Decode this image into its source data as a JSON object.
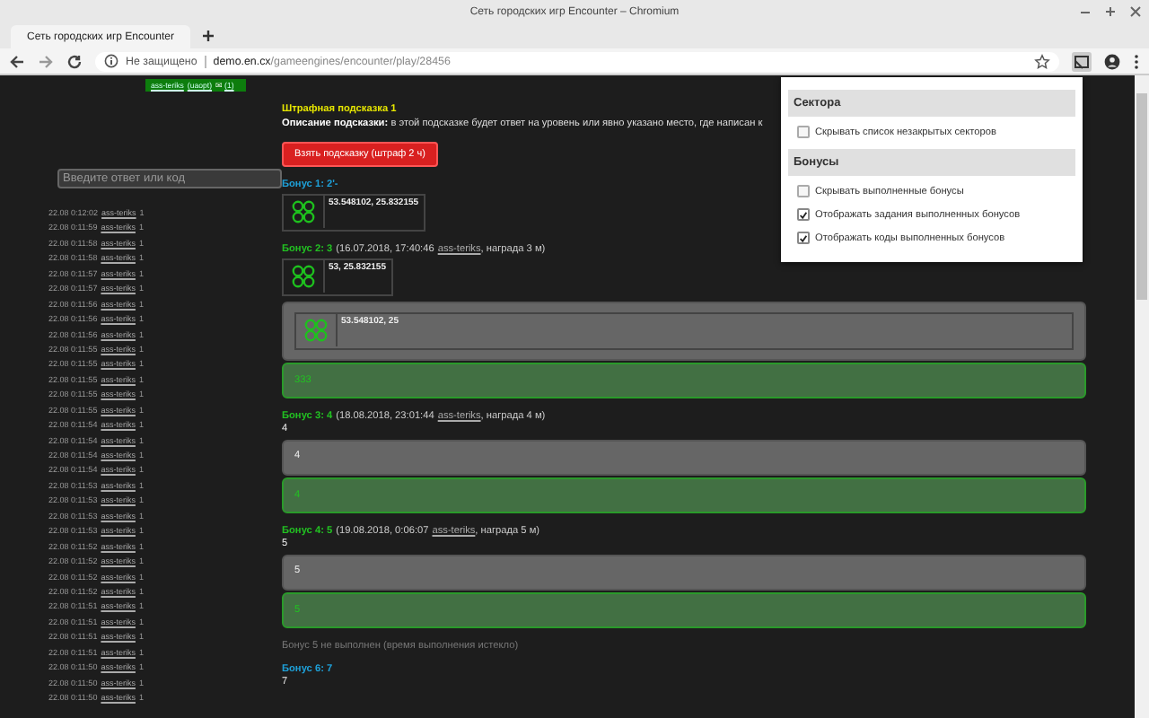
{
  "browser": {
    "window_title": "Сеть городских игр Encounter – Chromium",
    "tab_title": "Сеть городских игр Encounter",
    "security": "Не защищено",
    "url_host": "demo.en.cx",
    "url_path": "/gameengines/encounter/play/28456"
  },
  "sidebar": {
    "user_badge": {
      "user": "ass-teriks",
      "team": "(uaopt)",
      "mail": "✉",
      "mail_count": "(1)"
    },
    "answer_field": {
      "placeholder": "Введите ответ или код"
    },
    "log": [
      {
        "time": "22.08 0:12:02",
        "user": "ass-teriks",
        "value": "1"
      },
      {
        "time": "22.08 0:11:59",
        "user": "ass-teriks",
        "value": "1"
      },
      {
        "time": "22.08 0:11:58",
        "user": "ass-teriks",
        "value": "1"
      },
      {
        "time": "22.08 0:11:58",
        "user": "ass-teriks",
        "value": "1"
      },
      {
        "time": "22.08 0:11:57",
        "user": "ass-teriks",
        "value": "1"
      },
      {
        "time": "22.08 0:11:57",
        "user": "ass-teriks",
        "value": "1"
      },
      {
        "time": "22.08 0:11:56",
        "user": "ass-teriks",
        "value": "1"
      },
      {
        "time": "22.08 0:11:56",
        "user": "ass-teriks",
        "value": "1"
      },
      {
        "time": "22.08 0:11:56",
        "user": "ass-teriks",
        "value": "1"
      },
      {
        "time": "22.08 0:11:55",
        "user": "ass-teriks",
        "value": "1"
      },
      {
        "time": "22.08 0:11:55",
        "user": "ass-teriks",
        "value": "1"
      },
      {
        "time": "22.08 0:11:55",
        "user": "ass-teriks",
        "value": "1"
      },
      {
        "time": "22.08 0:11:55",
        "user": "ass-teriks",
        "value": "1"
      },
      {
        "time": "22.08 0:11:55",
        "user": "ass-teriks",
        "value": "1"
      },
      {
        "time": "22.08 0:11:54",
        "user": "ass-teriks",
        "value": "1"
      },
      {
        "time": "22.08 0:11:54",
        "user": "ass-teriks",
        "value": "1"
      },
      {
        "time": "22.08 0:11:54",
        "user": "ass-teriks",
        "value": "1"
      },
      {
        "time": "22.08 0:11:54",
        "user": "ass-teriks",
        "value": "1"
      },
      {
        "time": "22.08 0:11:53",
        "user": "ass-teriks",
        "value": "1"
      },
      {
        "time": "22.08 0:11:53",
        "user": "ass-teriks",
        "value": "1"
      },
      {
        "time": "22.08 0:11:53",
        "user": "ass-teriks",
        "value": "1"
      },
      {
        "time": "22.08 0:11:53",
        "user": "ass-teriks",
        "value": "1"
      },
      {
        "time": "22.08 0:11:52",
        "user": "ass-teriks",
        "value": "1"
      },
      {
        "time": "22.08 0:11:52",
        "user": "ass-teriks",
        "value": "1"
      },
      {
        "time": "22.08 0:11:52",
        "user": "ass-teriks",
        "value": "1"
      },
      {
        "time": "22.08 0:11:52",
        "user": "ass-teriks",
        "value": "1"
      },
      {
        "time": "22.08 0:11:51",
        "user": "ass-teriks",
        "value": "1"
      },
      {
        "time": "22.08 0:11:51",
        "user": "ass-teriks",
        "value": "1"
      },
      {
        "time": "22.08 0:11:51",
        "user": "ass-teriks",
        "value": "1"
      },
      {
        "time": "22.08 0:11:51",
        "user": "ass-teriks",
        "value": "1"
      },
      {
        "time": "22.08 0:11:50",
        "user": "ass-teriks",
        "value": "1"
      },
      {
        "time": "22.08 0:11:50",
        "user": "ass-teriks",
        "value": "1"
      },
      {
        "time": "22.08 0:11:50",
        "user": "ass-teriks",
        "value": "1"
      }
    ]
  },
  "hint": {
    "title": "Штрафная подсказка 1",
    "description_label": "Описание подсказки:",
    "description": "в этой подсказке будет ответ на уровень или явно указано место, где написан к",
    "button": "Взять подсказку (штраф 2 ч)"
  },
  "bonuses": [
    {
      "kind": "active",
      "title": "Бонус 1: 2'-",
      "task": {
        "kind": "image",
        "text": "53.548102, 25.832155"
      }
    },
    {
      "kind": "completed",
      "title": "Бонус 2: 3",
      "meta": {
        "time": "(16.07.2018, 17:40:46",
        "user": "ass-teriks",
        "reward": ", награда 3 м)"
      },
      "task": {
        "kind": "image",
        "text": "53, 25.832155"
      },
      "help": {
        "kind": "image",
        "text": "53.548102, 25"
      },
      "code": "333"
    },
    {
      "kind": "completed",
      "title": "Бонус 3: 4",
      "meta": {
        "time": "(18.08.2018, 23:01:44",
        "user": "ass-teriks",
        "reward": ", награда 4 м)"
      },
      "task": {
        "kind": "text",
        "text": "4"
      },
      "help": {
        "kind": "text",
        "text": "4"
      },
      "code": "4"
    },
    {
      "kind": "completed",
      "title": "Бонус 4: 5",
      "meta": {
        "time": "(19.08.2018, 0:06:07",
        "user": "ass-teriks",
        "reward": ", награда 5 м)"
      },
      "task": {
        "kind": "text",
        "text": "5"
      },
      "help": {
        "kind": "text",
        "text": "5"
      },
      "code": "5"
    },
    {
      "kind": "failed",
      "title": "Бонус 5 не выполнен (время выполнения истекло)"
    },
    {
      "kind": "active",
      "title": "Бонус 6: 7",
      "task": {
        "kind": "text",
        "text": "7"
      }
    }
  ],
  "settings_popup": {
    "sections": [
      {
        "title": "Сектора",
        "options": [
          {
            "label": "Скрывать список незакрытых секторов",
            "checked": false
          }
        ]
      },
      {
        "title": "Бонусы",
        "options": [
          {
            "label": "Скрывать выполненные бонусы",
            "checked": false
          },
          {
            "label": "Отображать задания выполненных бонусов",
            "checked": true
          },
          {
            "label": "Отображать коды выполненных бонусов",
            "checked": true
          }
        ]
      }
    ]
  }
}
